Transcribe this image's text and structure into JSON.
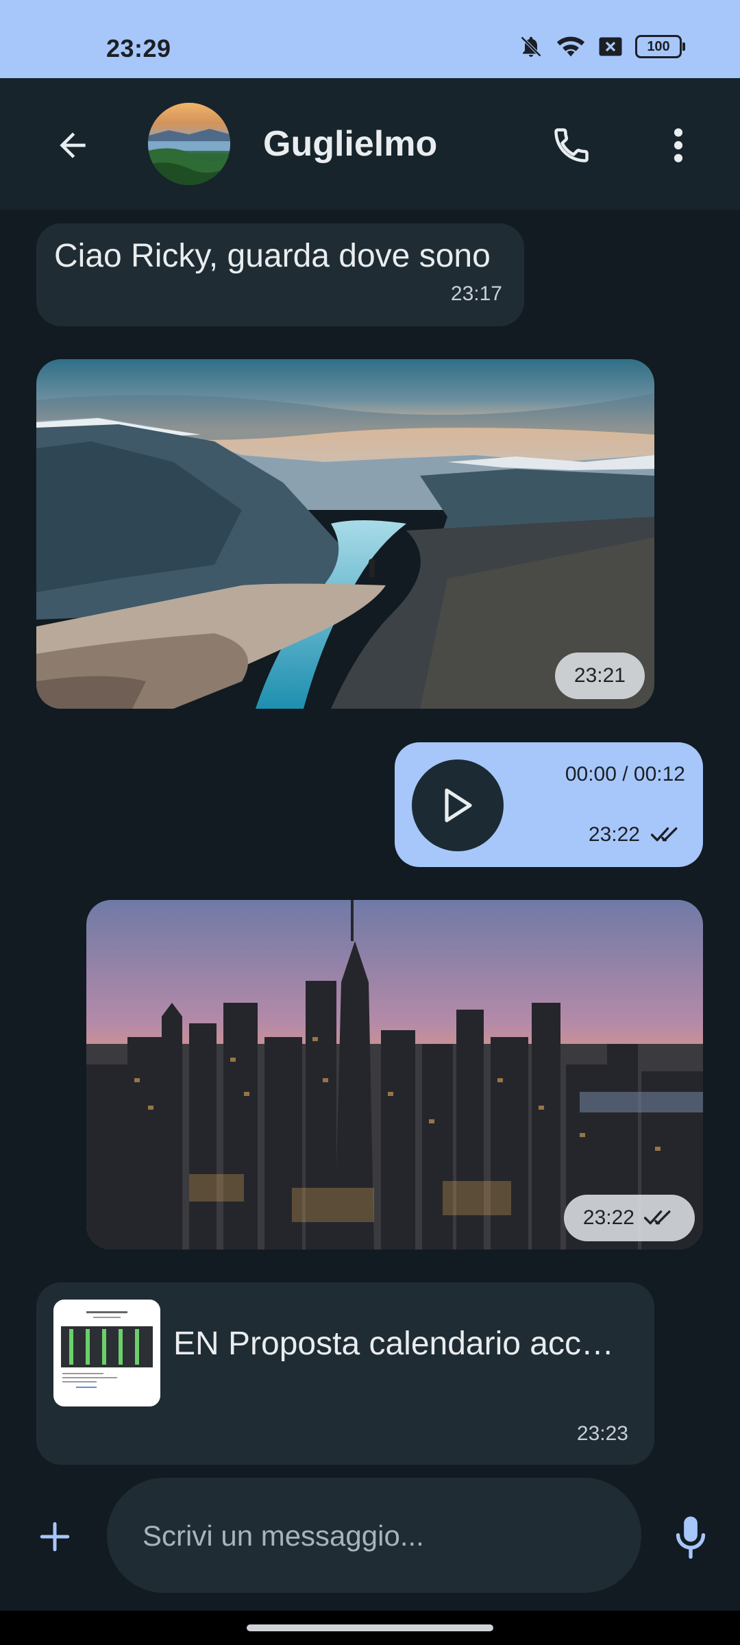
{
  "status_bar": {
    "time": "23:29",
    "battery": "100",
    "icons": [
      "bell-off-icon",
      "wifi-icon",
      "sim-x-icon",
      "battery-icon"
    ]
  },
  "app_bar": {
    "back_icon": "arrow-left-icon",
    "contact_name": "Guglielmo",
    "call_icon": "phone-icon",
    "more_icon": "more-vertical-icon"
  },
  "messages": [
    {
      "type": "text",
      "direction": "in",
      "text": "Ciao Ricky, guarda dove sono",
      "time": "23:17"
    },
    {
      "type": "image",
      "direction": "in",
      "subject": "fjord-cliff",
      "time": "23:21"
    },
    {
      "type": "audio",
      "direction": "out",
      "duration": "00:00 / 00:12",
      "time": "23:22",
      "status": "read"
    },
    {
      "type": "image",
      "direction": "out",
      "subject": "city-skyline-sunset",
      "time": "23:22",
      "status": "read"
    },
    {
      "type": "document",
      "direction": "in",
      "filename": "EN Proposta calendario acc…",
      "time": "23:23"
    }
  ],
  "composer": {
    "add_icon": "plus-icon",
    "placeholder": "Scrivi un messaggio...",
    "value": "",
    "mic_icon": "mic-icon"
  },
  "colors": {
    "background": "#111b21",
    "app_bar": "#17242b",
    "incoming_bubble": "#202c33",
    "outgoing_bubble": "#a7c7fb",
    "status_bar": "#a7c7fb"
  }
}
